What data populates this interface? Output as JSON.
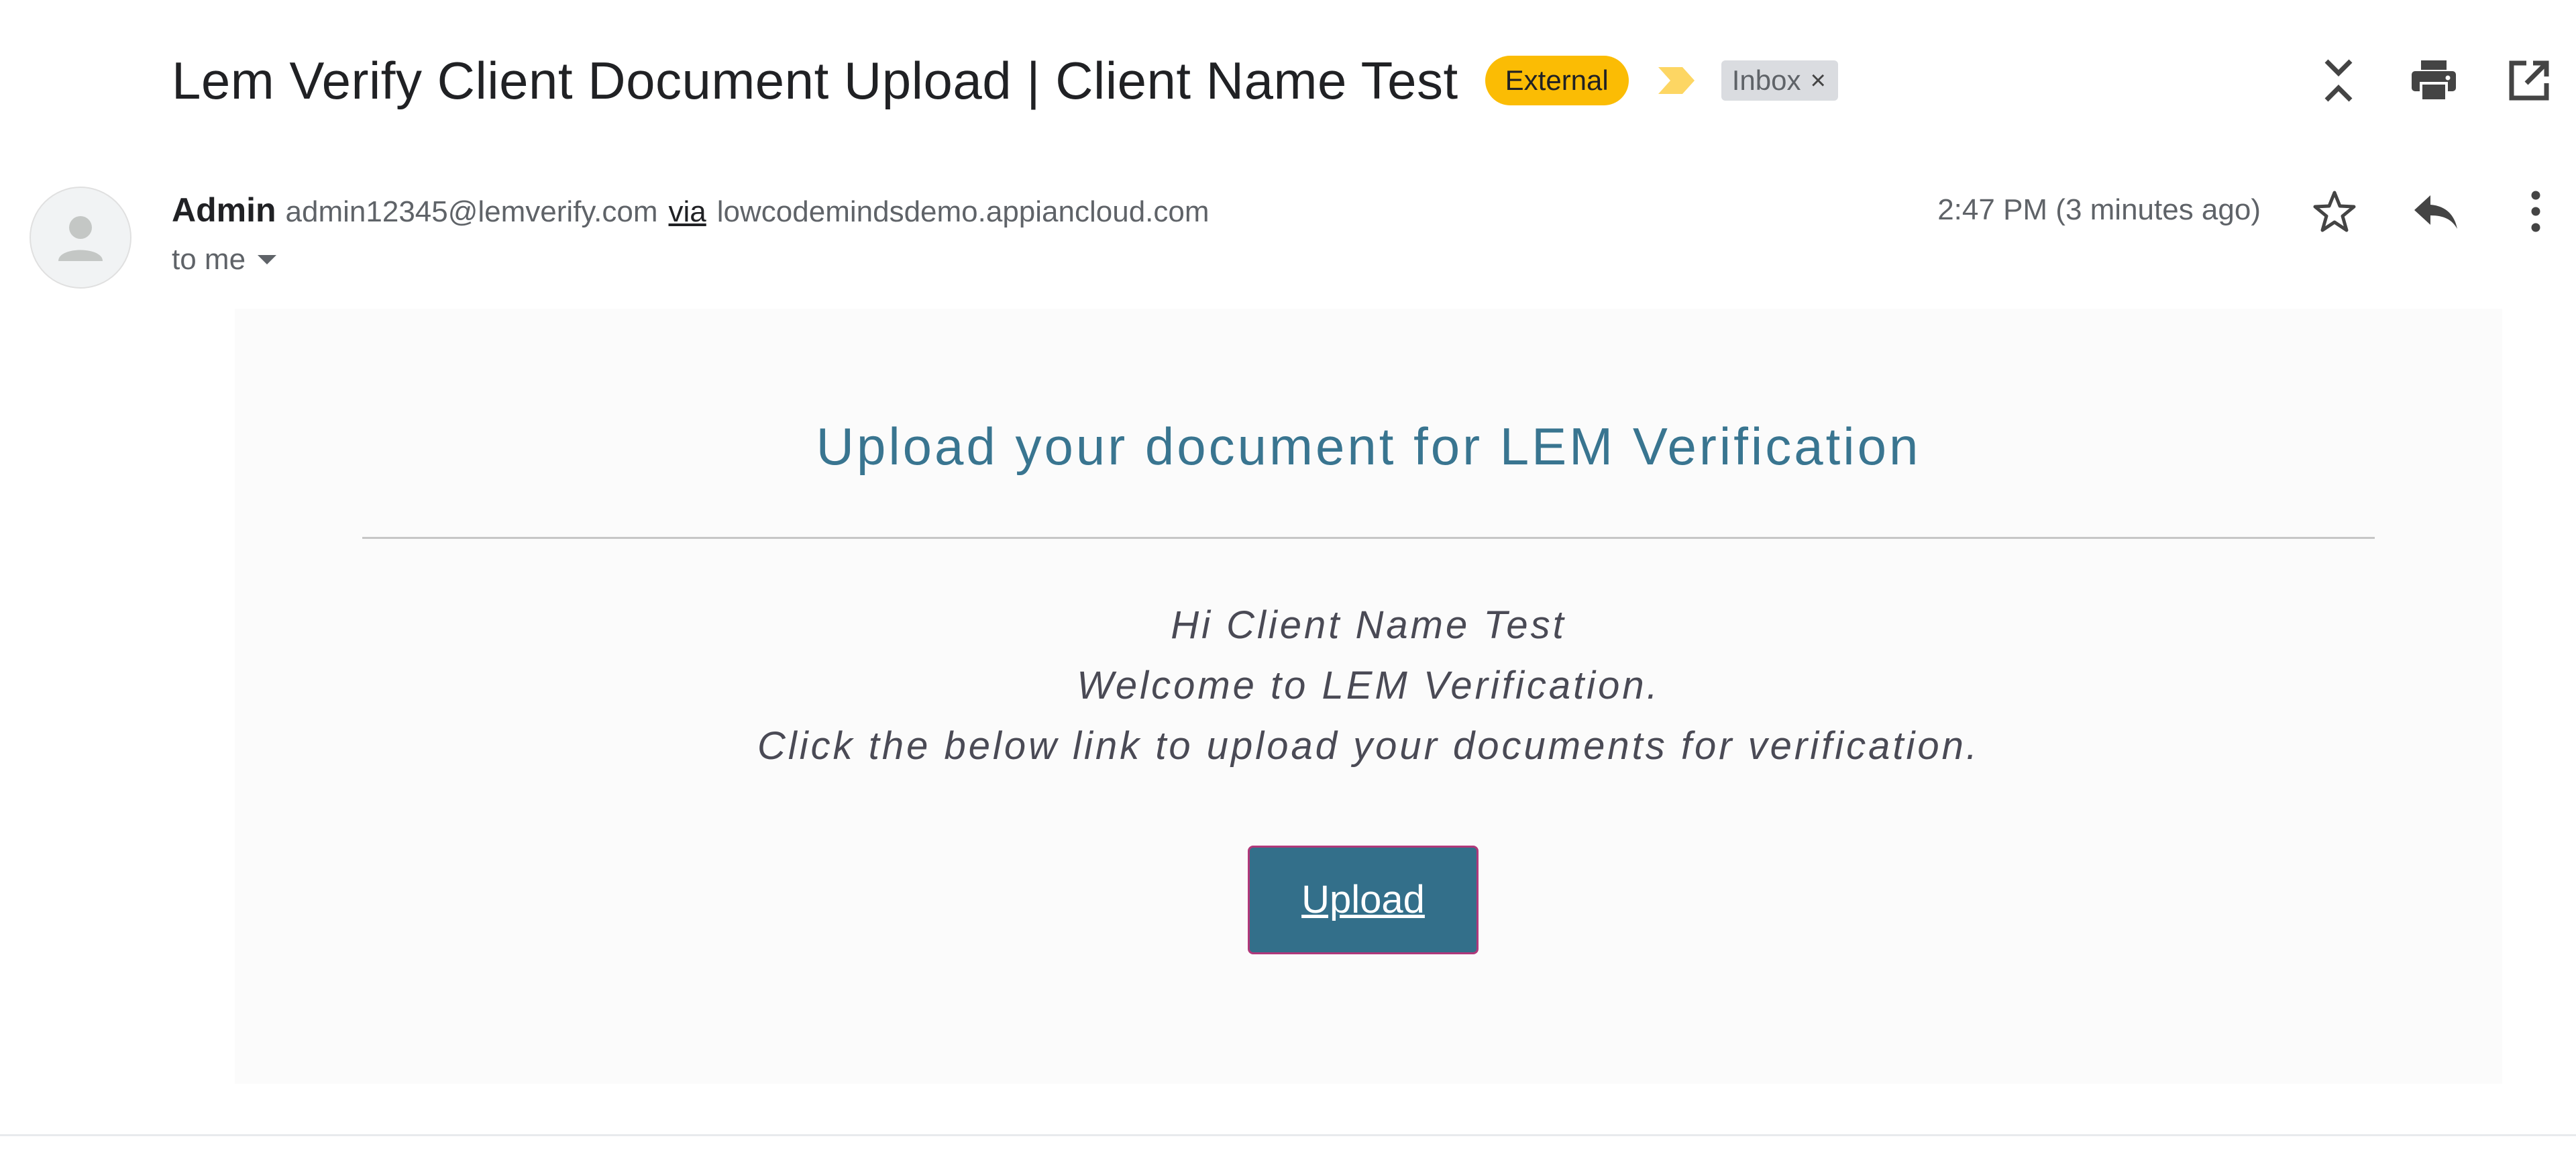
{
  "subject": "Lem Verify Client Document Upload | Client Name Test",
  "labels": {
    "external": "External",
    "inbox": "Inbox",
    "inbox_remove": "×"
  },
  "icons": {
    "important": "important-marker-icon",
    "expand_collapse": "collapse-expand-icon",
    "print": "print-icon",
    "open_new_window": "open-in-new-window-icon",
    "avatar": "person-icon",
    "star": "star-icon",
    "reply": "reply-icon",
    "more": "more-vertical-icon",
    "recipient_caret": "caret-down-icon"
  },
  "sender": {
    "name": "Admin",
    "email": "admin12345@lemverify.com",
    "via": "via",
    "domain": "lowcodemindsdemo.appiancloud.com",
    "to": "to me",
    "timestamp": "2:47 PM (3 minutes ago)"
  },
  "body": {
    "title": "Upload your document for LEM Verification",
    "greeting": "Hi Client Name Test",
    "welcome": "Welcome to LEM Verification.",
    "instruction": "Click the below link to upload your documents for verification.",
    "button_label": "Upload"
  },
  "colors": {
    "external_badge": "#fbbc04",
    "title": "#397590",
    "button_bg": "#336f8a",
    "button_border": "#b0387a",
    "important_marker": "#fdd663"
  }
}
